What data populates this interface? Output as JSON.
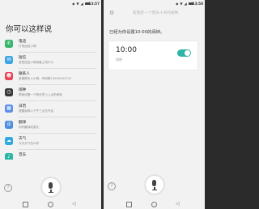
{
  "colors": {
    "accent": "#2cb5a7"
  },
  "left_screen": {
    "status_time": "13:57",
    "status_icons": "◆ ▼ ◢",
    "heading": "你可以这样说",
    "items": [
      {
        "icon": "phone-icon",
        "glyph": "✆",
        "color": "#35b56a",
        "title": "电话",
        "desc": "打电话给小明"
      },
      {
        "icon": "message-icon",
        "glyph": "✉",
        "color": "#3ea6e6",
        "title": "短信",
        "desc": "发短信给小明说晚上吃什么"
      },
      {
        "icon": "contacts-icon",
        "glyph": "☻",
        "color": "#e8475a",
        "title": "联系人",
        "desc": "新建联系人小明，号码是1395XXX2747"
      },
      {
        "icon": "clock-icon",
        "glyph": "◷",
        "color": "#3a3a3a",
        "title": "闹钟",
        "desc": "帮我设置一个明天早上八点的闹钟"
      },
      {
        "icon": "calendar-icon",
        "glyph": "▦",
        "color": "#5b8fe8",
        "title": "日历",
        "desc": "提醒我周六下午三点去开会"
      },
      {
        "icon": "translate-icon",
        "glyph": "译",
        "color": "#4a8fe0",
        "title": "翻译",
        "desc": "你好翻译成英文"
      },
      {
        "icon": "weather-icon",
        "glyph": "☁",
        "color": "#31a8e0",
        "title": "天气",
        "desc": "今天天气怎么样"
      },
      {
        "icon": "music-icon",
        "glyph": "♪",
        "color": "#2cb5a7",
        "title": "音乐",
        "desc": ""
      }
    ],
    "help_glyph": "?"
  },
  "right_screen": {
    "status_time": "13:58",
    "status_icons": "◆ ▼ ◢",
    "hint": "帮我定一个明天十点的闹钟",
    "gear_glyph": "⚙",
    "reply": "已经为你设置10:00的闹钟。",
    "alarm_time": "10:00",
    "alarm_label": "闹钟",
    "alarm_on": true,
    "help_glyph": "?"
  },
  "navbar": {
    "back_glyph": "◁"
  }
}
